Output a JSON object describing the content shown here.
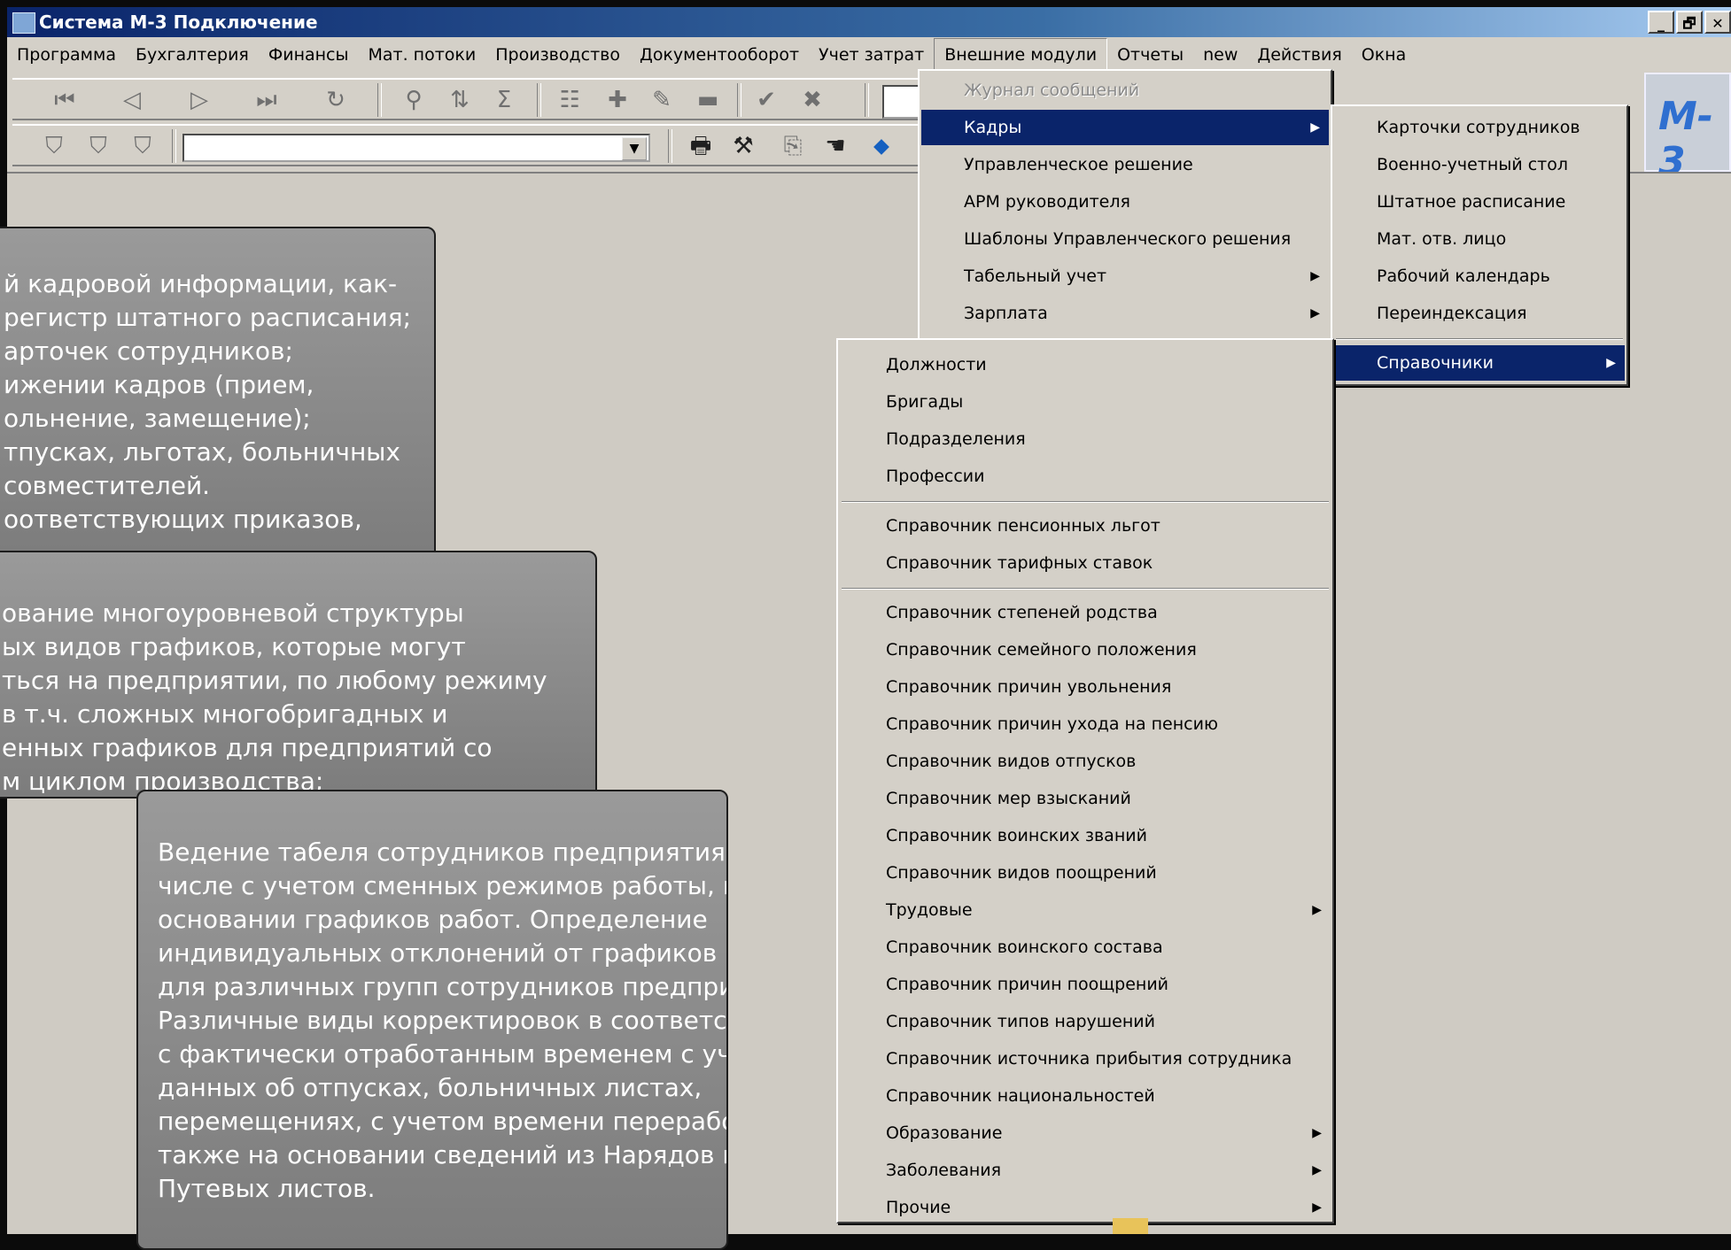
{
  "window": {
    "title": "Система М-3 Подключение",
    "buttons": [
      "_",
      "🗗",
      "✕"
    ]
  },
  "menubar": [
    {
      "label": "Программа"
    },
    {
      "label": "Бухгалтерия"
    },
    {
      "label": "Финансы"
    },
    {
      "label": "Мат. потоки"
    },
    {
      "label": "Производство"
    },
    {
      "label": "Документооборот"
    },
    {
      "label": "Учет затрат"
    },
    {
      "label": "Внешние модули",
      "active": true
    },
    {
      "label": "Отчеты"
    },
    {
      "label": "new"
    },
    {
      "label": "Действия"
    },
    {
      "label": "Окна"
    }
  ],
  "logo": "M-3",
  "info_box_1": [
    "й кадровой информации, как-",
    "регистр штатного расписания;",
    "арточек сотрудников;",
    "ижении кадров (прием,",
    "ольнение, замещение);",
    "тпусках, льготах, больничных",
    " совместителей.",
    "оответствующих приказов,"
  ],
  "info_box_2": [
    "ование многоуровневой структуры",
    "ых видов графиков, которые могут",
    "ться на предприятии, по любому режиму",
    "в т.ч. сложных многобригадных и",
    "енных графиков для предприятий со",
    "м циклом производства;"
  ],
  "info_box_3": [
    "Ведение табеля сотрудников предприятия, в том",
    "числе с учетом сменных режимов работы, на",
    "основании графиков работ. Определение",
    "индивидуальных отклонений от графиков работы",
    "для различных групп сотрудников предприятия.",
    "Различные виды корректировок в соответствие",
    "с фактически отработанным временем с учетом",
    "данных об отпусках, больничных листах,",
    "перемещениях, с учетом времени переработок, а",
    "также на основании сведений из Нарядов и",
    "Путевых листов."
  ],
  "menu_external": [
    {
      "label": "Журнал сообщений",
      "disabled": true
    },
    {
      "label": "Кадры",
      "selected": true,
      "submenu": true
    },
    {
      "label": "Управленческое решение"
    },
    {
      "label": "АРМ руководителя"
    },
    {
      "label": "Шаблоны Управленческого решения"
    },
    {
      "label": "Табельный учет",
      "submenu": true
    },
    {
      "label": "Зарплата",
      "submenu": true
    }
  ],
  "menu_kadry": [
    {
      "label": "Карточки сотрудников"
    },
    {
      "label": "Военно-учетный стол"
    },
    {
      "label": "Штатное расписание"
    },
    {
      "label": "Мат. отв. лицо"
    },
    {
      "label": "Рабочий календарь"
    },
    {
      "label": "Переиндексация"
    },
    {
      "label": "Справочники",
      "selected": true,
      "submenu": true
    }
  ],
  "menu_spravochniki": [
    {
      "label": "Должности"
    },
    {
      "label": "Бригады"
    },
    {
      "label": "Подразделения"
    },
    {
      "label": "Профессии"
    },
    {
      "label": "Справочник пенсионных льгот"
    },
    {
      "label": "Справочник тарифных ставок"
    },
    {
      "label": "Справочник степеней родства"
    },
    {
      "label": "Справочник семейного положения"
    },
    {
      "label": "Справочник причин увольнения"
    },
    {
      "label": "Справочник причин ухода на пенсию"
    },
    {
      "label": "Справочник видов отпусков"
    },
    {
      "label": "Справочник мер взысканий"
    },
    {
      "label": "Справочник воинских званий"
    },
    {
      "label": "Справочник видов поощрений"
    },
    {
      "label": "Трудовые",
      "submenu": true
    },
    {
      "label": "Справочник воинского состава"
    },
    {
      "label": "Справочник причин поощрений"
    },
    {
      "label": "Справочник типов нарушений"
    },
    {
      "label": "Справочник источника прибытия сотрудника"
    },
    {
      "label": "Справочник национальностей"
    },
    {
      "label": "Образование",
      "submenu": true
    },
    {
      "label": "Заболевания",
      "submenu": true
    },
    {
      "label": "Прочие",
      "submenu": true
    }
  ],
  "colors": {
    "selection": "#0a246a",
    "face": "#d4d0c8",
    "logo": "#2f6fd0"
  }
}
